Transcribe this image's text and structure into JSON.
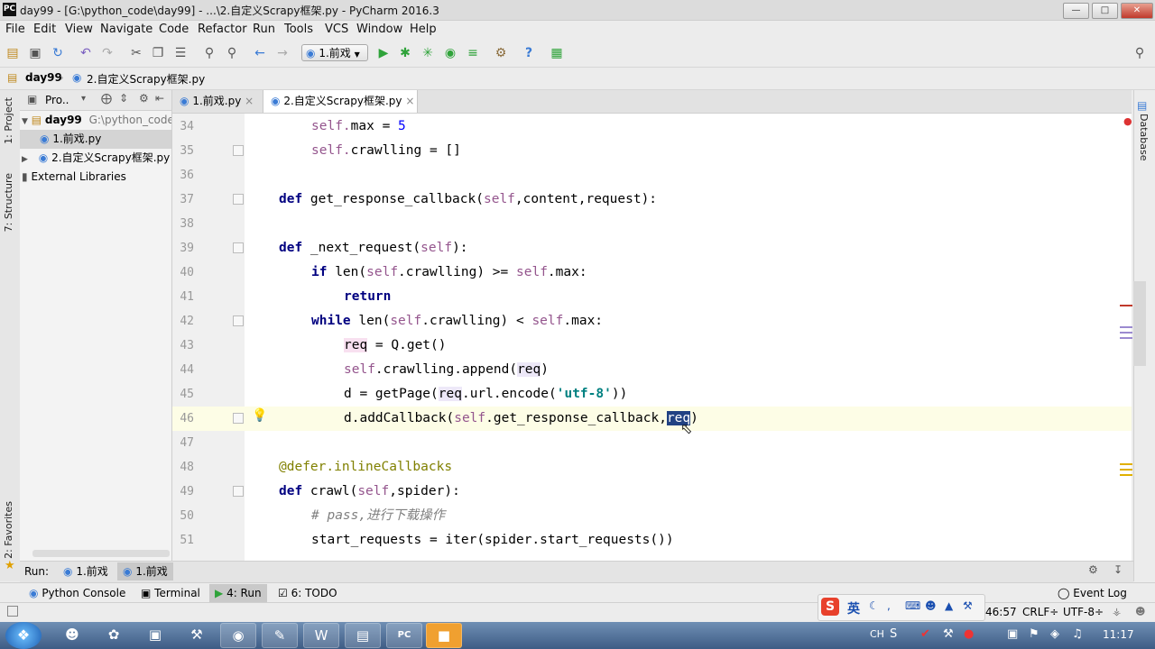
{
  "window": {
    "title": "day99 - [G:\\python_code\\day99] - ...\\2.自定义Scrapy框架.py - PyCharm 2016.3",
    "app_icon": "PC"
  },
  "menu": [
    "File",
    "Edit",
    "View",
    "Navigate",
    "Code",
    "Refactor",
    "Run",
    "Tools",
    "VCS",
    "Window",
    "Help"
  ],
  "toolbar": {
    "run_config": "1.前戏"
  },
  "breadcrumb": [
    "day99",
    "2.自定义Scrapy框架.py"
  ],
  "left_strip": {
    "project": "1: Project",
    "structure": "7: Structure",
    "favorites": "2: Favorites"
  },
  "project_panel": {
    "header": "Pro..",
    "root_name": "day99",
    "root_path": "G:\\python_code\\d",
    "files": [
      "1.前戏.py",
      "2.自定义Scrapy框架.py"
    ],
    "external": "External Libraries"
  },
  "tabs": [
    {
      "label": "1.前戏.py",
      "active": false
    },
    {
      "label": "2.自定义Scrapy框架.py",
      "active": true
    }
  ],
  "editor": {
    "current_line": "46",
    "lines": [
      {
        "n": "34",
        "indent": 2,
        "parts": [
          [
            "self",
            "self."
          ],
          [
            "t",
            "max = "
          ],
          [
            "num",
            "5"
          ]
        ]
      },
      {
        "n": "35",
        "indent": 2,
        "parts": [
          [
            "self",
            "self."
          ],
          [
            "t",
            "crawlling = []"
          ]
        ]
      },
      {
        "n": "36",
        "indent": 0,
        "parts": []
      },
      {
        "n": "37",
        "indent": 1,
        "parts": [
          [
            "kw",
            "def "
          ],
          [
            "t",
            "get_response_callback("
          ],
          [
            "self",
            "self"
          ],
          [
            "t",
            ",content,request):"
          ]
        ]
      },
      {
        "n": "38",
        "indent": 0,
        "parts": []
      },
      {
        "n": "39",
        "indent": 1,
        "parts": [
          [
            "kw",
            "def "
          ],
          [
            "t",
            "_next_request("
          ],
          [
            "self",
            "self"
          ],
          [
            "t",
            "):"
          ]
        ]
      },
      {
        "n": "40",
        "indent": 2,
        "parts": [
          [
            "kw",
            "if "
          ],
          [
            "t",
            "len("
          ],
          [
            "self",
            "self"
          ],
          [
            "t",
            ".crawlling) >= "
          ],
          [
            "self",
            "self"
          ],
          [
            "t",
            ".max:"
          ]
        ]
      },
      {
        "n": "41",
        "indent": 3,
        "parts": [
          [
            "kw",
            "return"
          ]
        ]
      },
      {
        "n": "42",
        "indent": 2,
        "parts": [
          [
            "kw",
            "while "
          ],
          [
            "t",
            "len("
          ],
          [
            "self",
            "self"
          ],
          [
            "t",
            ".crawlling) < "
          ],
          [
            "self",
            "self"
          ],
          [
            "t",
            ".max:"
          ]
        ]
      },
      {
        "n": "43",
        "indent": 3,
        "parts": [
          [
            "hlp",
            "req"
          ],
          [
            "t",
            " = Q.get()"
          ]
        ]
      },
      {
        "n": "44",
        "indent": 3,
        "parts": [
          [
            "self",
            "self"
          ],
          [
            "t",
            ".crawlling.append("
          ],
          [
            "hl",
            "req"
          ],
          [
            "t",
            ")"
          ]
        ]
      },
      {
        "n": "45",
        "indent": 3,
        "parts": [
          [
            "t",
            "d = getPage("
          ],
          [
            "hl",
            "req"
          ],
          [
            "t",
            ".url.encode("
          ],
          [
            "str",
            "'utf-8'"
          ],
          [
            "t",
            "))"
          ]
        ]
      },
      {
        "n": "46",
        "indent": 3,
        "parts": [
          [
            "t",
            "d.addCallback("
          ],
          [
            "self",
            "self"
          ],
          [
            "t",
            ".get_response_callback,"
          ],
          [
            "sel",
            "req"
          ],
          [
            "t",
            ")"
          ]
        ]
      },
      {
        "n": "47",
        "indent": 0,
        "parts": []
      },
      {
        "n": "48",
        "indent": 1,
        "parts": [
          [
            "dec",
            "@defer.inlineCallbacks"
          ]
        ]
      },
      {
        "n": "49",
        "indent": 1,
        "parts": [
          [
            "kw",
            "def "
          ],
          [
            "t",
            "crawl("
          ],
          [
            "self",
            "self"
          ],
          [
            "t",
            ",spider):"
          ]
        ]
      },
      {
        "n": "50",
        "indent": 2,
        "parts": [
          [
            "cmt",
            "# pass,进行下载操作"
          ]
        ]
      },
      {
        "n": "51",
        "indent": 2,
        "parts": [
          [
            "t",
            "start_requests = iter(spider.start_requests())"
          ]
        ]
      }
    ]
  },
  "right_strip": {
    "database": "Database"
  },
  "run_bar": {
    "label": "Run:",
    "tab1": "1.前戏",
    "tab2": "1.前戏"
  },
  "tool_windows": [
    "Python Console",
    "Terminal",
    "4: Run",
    "6: TODO",
    "Event Log"
  ],
  "status": {
    "position": "46:57",
    "line_sep": "CRLF÷",
    "encoding": "UTF-8÷"
  },
  "tray": {
    "ime": "英",
    "lang": "CH",
    "time": "11:17"
  },
  "colors": {
    "keyword": "#000080",
    "self": "#94558d",
    "string": "#008080",
    "number": "#0000ff",
    "comment": "#808080",
    "decorator": "#808000",
    "selection": "#214283",
    "current_line": "#fdfde6"
  }
}
